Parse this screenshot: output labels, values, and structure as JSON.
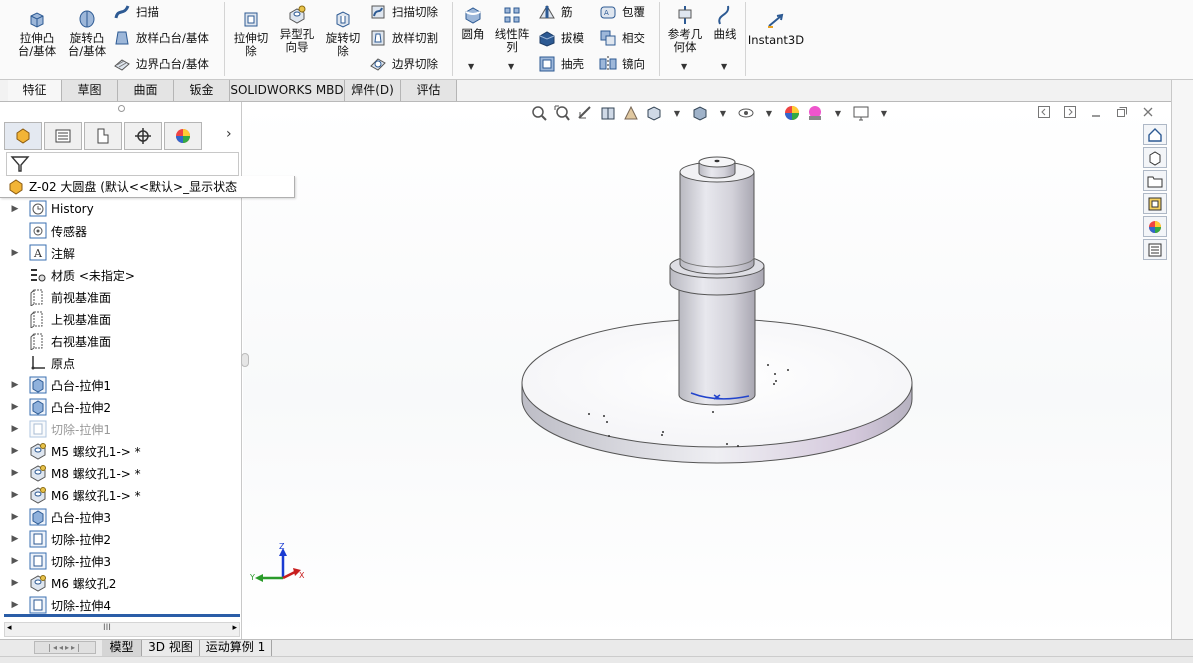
{
  "ribbon": {
    "extrude_boss": "拉伸凸\n台/基体",
    "revolve_boss": "旋转凸\n台/基体",
    "sweep": "扫描",
    "loft_boss": "放样凸台/基体",
    "boundary_boss": "边界凸台/基体",
    "extrude_cut": "拉伸切\n除",
    "hole_wizard": "异型孔\n向导",
    "revolve_cut": "旋转切\n除",
    "sweep_cut": "扫描切除",
    "loft_cut": "放样切割",
    "boundary_cut": "边界切除",
    "fillet": "圆角",
    "linear_pattern": "线性阵\n列",
    "rib": "筋",
    "draft": "拔模",
    "shell": "抽壳",
    "wrap": "包覆",
    "intersect": "相交",
    "mirror": "镜向",
    "ref_geometry": "参考几\n何体",
    "curves": "曲线",
    "instant3d": "Instant3D"
  },
  "tabs": [
    "特征",
    "草图",
    "曲面",
    "钣金",
    "SOLIDWORKS MBD",
    "焊件(D)",
    "评估"
  ],
  "tree": {
    "root": "Z-02 大圆盘 (默认<<默认>_显示状态",
    "items": [
      {
        "label": "History",
        "icon": "history-icon",
        "arrow": true
      },
      {
        "label": "传感器",
        "icon": "sensor-icon",
        "arrow": false
      },
      {
        "label": "注解",
        "icon": "annotation-icon",
        "arrow": true
      },
      {
        "label": "材质 <未指定>",
        "icon": "material-icon",
        "arrow": false
      },
      {
        "label": "前视基准面",
        "icon": "plane-icon",
        "arrow": false
      },
      {
        "label": "上视基准面",
        "icon": "plane-icon",
        "arrow": false
      },
      {
        "label": "右视基准面",
        "icon": "plane-icon",
        "arrow": false
      },
      {
        "label": "原点",
        "icon": "origin-icon",
        "arrow": false
      },
      {
        "label": "凸台-拉伸1",
        "icon": "boss-extrude-icon",
        "arrow": true
      },
      {
        "label": "凸台-拉伸2",
        "icon": "boss-extrude-icon",
        "arrow": true
      },
      {
        "label": "切除-拉伸1",
        "icon": "cut-extrude-icon",
        "arrow": true,
        "dim": true
      },
      {
        "label": "M5 螺纹孔1-> *",
        "icon": "hole-icon",
        "arrow": true
      },
      {
        "label": "M8 螺纹孔1-> *",
        "icon": "hole-icon",
        "arrow": true
      },
      {
        "label": "M6 螺纹孔1-> *",
        "icon": "hole-icon",
        "arrow": true
      },
      {
        "label": "凸台-拉伸3",
        "icon": "boss-extrude-icon",
        "arrow": true
      },
      {
        "label": "切除-拉伸2",
        "icon": "cut-extrude-icon",
        "arrow": true
      },
      {
        "label": "切除-拉伸3",
        "icon": "cut-extrude-icon",
        "arrow": true
      },
      {
        "label": "M6 螺纹孔2",
        "icon": "hole-icon",
        "arrow": true
      },
      {
        "label": "切除-拉伸4",
        "icon": "cut-extrude-icon",
        "arrow": true
      }
    ]
  },
  "bottom_tabs": [
    "模型",
    "3D 视图",
    "运动算例 1"
  ],
  "colors": {
    "accent": "#2a5da7",
    "tree_icon": "#3a6fb0"
  }
}
